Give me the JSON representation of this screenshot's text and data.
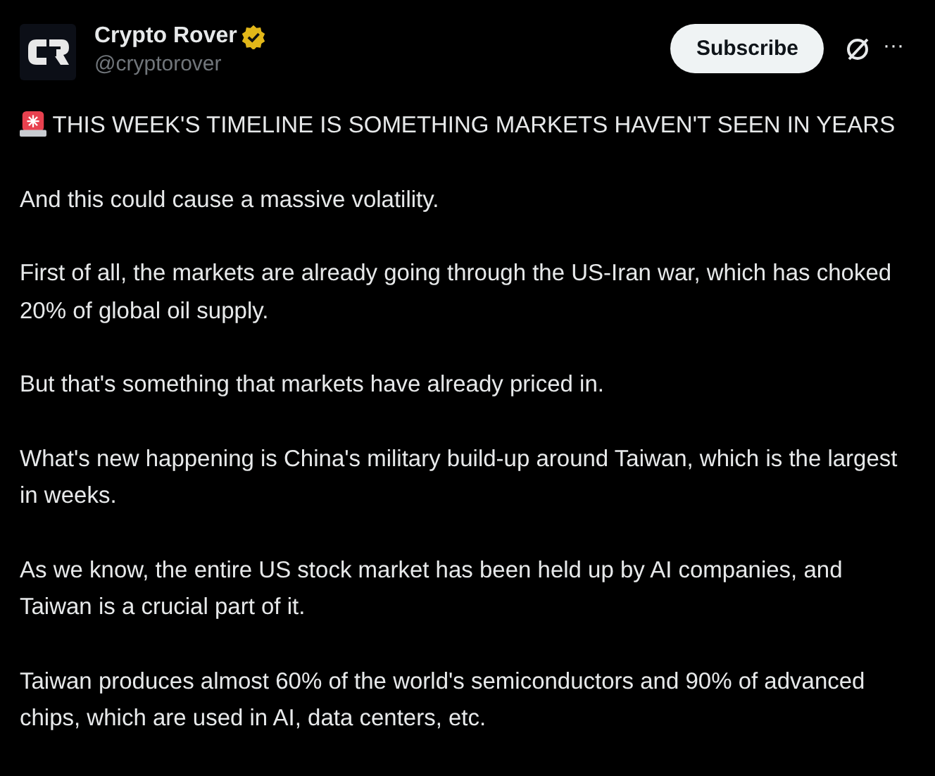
{
  "author": {
    "name": "Crypto Rover",
    "verified": true,
    "handle": "@cryptorover"
  },
  "subscribe_button": "Subscribe",
  "more_button": "···",
  "paragraphs": [
    {
      "alert_icon": true,
      "text": "THIS WEEK'S TIMELINE IS SOMETHING MARKETS HAVEN'T SEEN IN YEARS"
    },
    {
      "alert_icon": false,
      "text": "And this could cause a massive volatility."
    },
    {
      "alert_icon": false,
      "text": "First of all, the markets are already going through the US-Iran war, which has choked 20% of global oil supply."
    },
    {
      "alert_icon": false,
      "text": "But that's something that markets have already priced in."
    },
    {
      "alert_icon": false,
      "text": "What's new happening is China's military build-up around Taiwan, which is the largest in weeks."
    },
    {
      "alert_icon": false,
      "text": "As we know, the entire US stock market has been held up by AI companies, and Taiwan is a crucial part of it."
    },
    {
      "alert_icon": false,
      "text": "Taiwan produces almost 60% of the world's semiconductors and 90% of advanced chips, which are used in AI, data centers, etc."
    }
  ]
}
